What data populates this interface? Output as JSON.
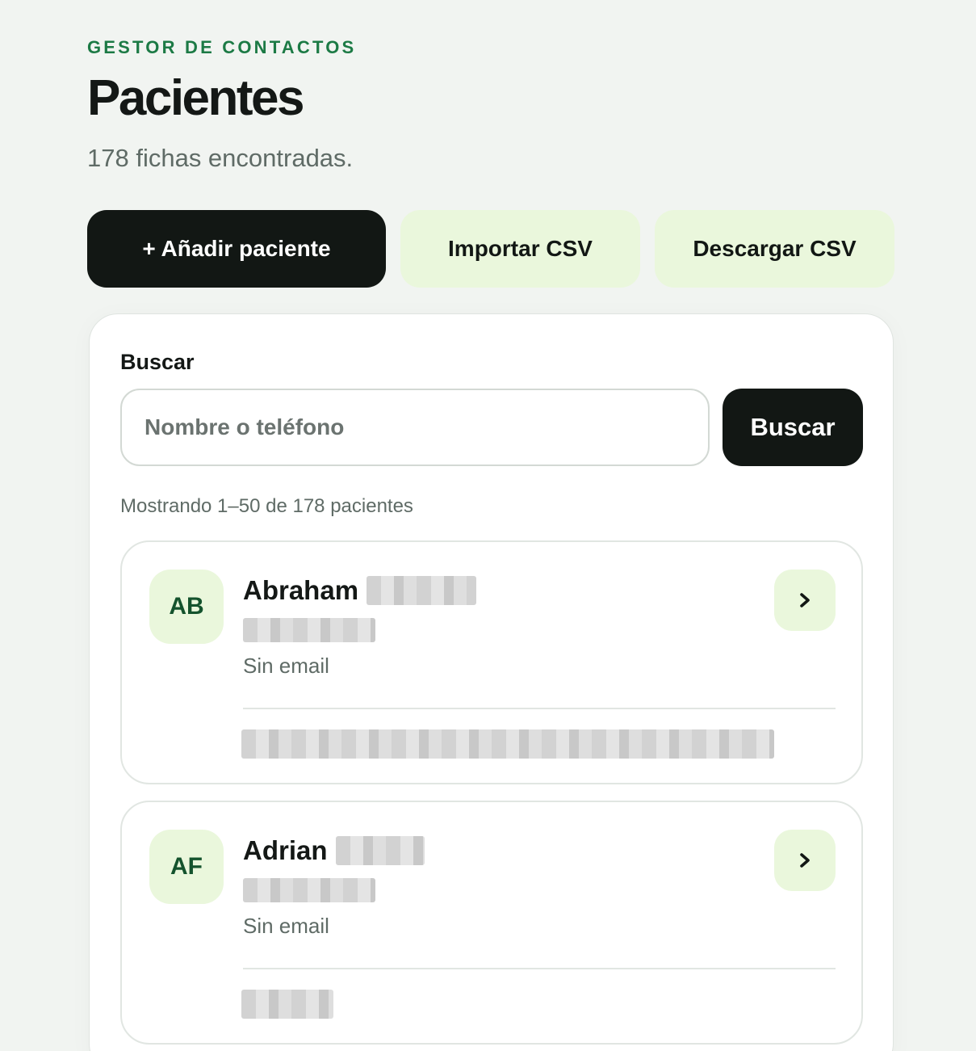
{
  "header": {
    "eyebrow": "GESTOR DE CONTACTOS",
    "title": "Pacientes",
    "subtitle": "178 fichas encontradas."
  },
  "actions": {
    "add_label": "+ Añadir paciente",
    "import_label": "Importar CSV",
    "export_label": "Descargar CSV"
  },
  "search": {
    "label": "Buscar",
    "placeholder": "Nombre o teléfono",
    "value": "",
    "button_label": "Buscar"
  },
  "results": {
    "summary": "Mostrando 1–50 de 178 pacientes"
  },
  "patients": [
    {
      "initials": "AB",
      "first_name": "Abraham",
      "email": "Sin email"
    },
    {
      "initials": "AF",
      "first_name": "Adrian",
      "email": "Sin email"
    }
  ],
  "icons": {
    "chevron": "chevron-right-icon"
  },
  "colors": {
    "background": "#f1f4f1",
    "accent_green": "#1c7a45",
    "dark_button": "#121714",
    "soft_green": "#eaf7dc",
    "avatar_text": "#14532d",
    "muted_text": "#5f6b66"
  }
}
